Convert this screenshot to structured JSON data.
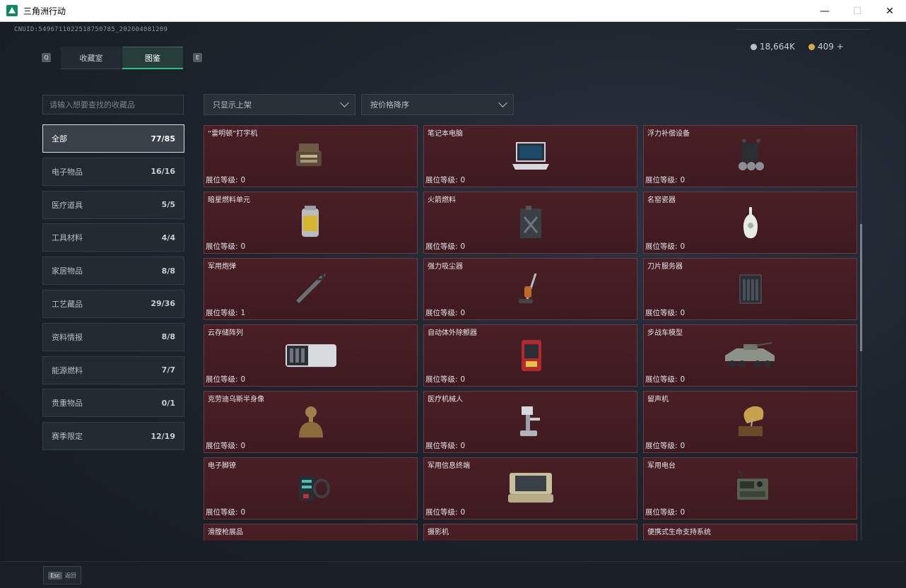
{
  "window": {
    "title": "三角洲行动",
    "controls": {
      "minimize": "—",
      "maximize": "☐",
      "close": "✕"
    }
  },
  "header": {
    "uid": "CNUID:5496711022518750785_202604081209",
    "key_left": "Q",
    "key_right": "E",
    "tabs": [
      {
        "label": "收藏室",
        "active": false
      },
      {
        "label": "图鉴",
        "active": true
      }
    ],
    "currency": [
      {
        "value": "18,664K",
        "color": "#b9bfc6"
      },
      {
        "value": "409 +",
        "color": "#d8a84a"
      }
    ]
  },
  "sidebar": {
    "search_placeholder": "请输入想要查找的收藏品",
    "categories": [
      {
        "label": "全部",
        "count": "77/85",
        "selected": true
      },
      {
        "label": "电子物品",
        "count": "16/16"
      },
      {
        "label": "医疗道具",
        "count": "5/5"
      },
      {
        "label": "工具材料",
        "count": "4/4"
      },
      {
        "label": "家居物品",
        "count": "8/8"
      },
      {
        "label": "工艺藏品",
        "count": "29/36"
      },
      {
        "label": "资料情报",
        "count": "8/8"
      },
      {
        "label": "能源燃料",
        "count": "7/7"
      },
      {
        "label": "贵重物品",
        "count": "0/1"
      },
      {
        "label": "赛季限定",
        "count": "12/19"
      }
    ]
  },
  "filters": {
    "shelf": "只显示上架",
    "sort": "按价格降序"
  },
  "level_label": "展位等级:",
  "items": [
    {
      "name": "“雷明顿”打字机",
      "level": "0",
      "icon": "typewriter-icon"
    },
    {
      "name": "笔记本电脑",
      "level": "0",
      "icon": "laptop-icon"
    },
    {
      "name": "浮力补偿设备",
      "level": "0",
      "icon": "buoyancy-device-icon"
    },
    {
      "name": "暗星燃料单元",
      "level": "0",
      "icon": "fuel-cell-icon"
    },
    {
      "name": "火箭燃料",
      "level": "0",
      "icon": "rocket-fuel-icon"
    },
    {
      "name": "名窑瓷器",
      "level": "0",
      "icon": "porcelain-vase-icon"
    },
    {
      "name": "军用炮弹",
      "level": "1",
      "icon": "artillery-shell-icon"
    },
    {
      "name": "强力吸尘器",
      "level": "0",
      "icon": "vacuum-cleaner-icon"
    },
    {
      "name": "刀片服务器",
      "level": "0",
      "icon": "blade-server-icon"
    },
    {
      "name": "云存储阵列",
      "level": "0",
      "icon": "storage-array-icon"
    },
    {
      "name": "自动体外除颤器",
      "level": "0",
      "icon": "defibrillator-icon"
    },
    {
      "name": "步战车模型",
      "level": "0",
      "icon": "ifv-model-icon"
    },
    {
      "name": "克劳迪乌斯半身像",
      "level": "0",
      "icon": "bust-icon"
    },
    {
      "name": "医疗机械人",
      "level": "0",
      "icon": "medical-robot-icon"
    },
    {
      "name": "留声机",
      "level": "0",
      "icon": "gramophone-icon"
    },
    {
      "name": "电子脚镣",
      "level": "0",
      "icon": "ankle-monitor-icon"
    },
    {
      "name": "军用信息终端",
      "level": "0",
      "icon": "military-terminal-icon"
    },
    {
      "name": "军用电台",
      "level": "0",
      "icon": "military-radio-icon"
    },
    {
      "name": "滑膛枪展品",
      "level": "",
      "icon": "musket-icon"
    },
    {
      "name": "摄影机",
      "level": "",
      "icon": "camera-icon"
    },
    {
      "name": "便携式生命支持系统",
      "level": "",
      "icon": "life-support-icon"
    }
  ],
  "footer": {
    "esc": "Esc",
    "back_label": "返回"
  }
}
